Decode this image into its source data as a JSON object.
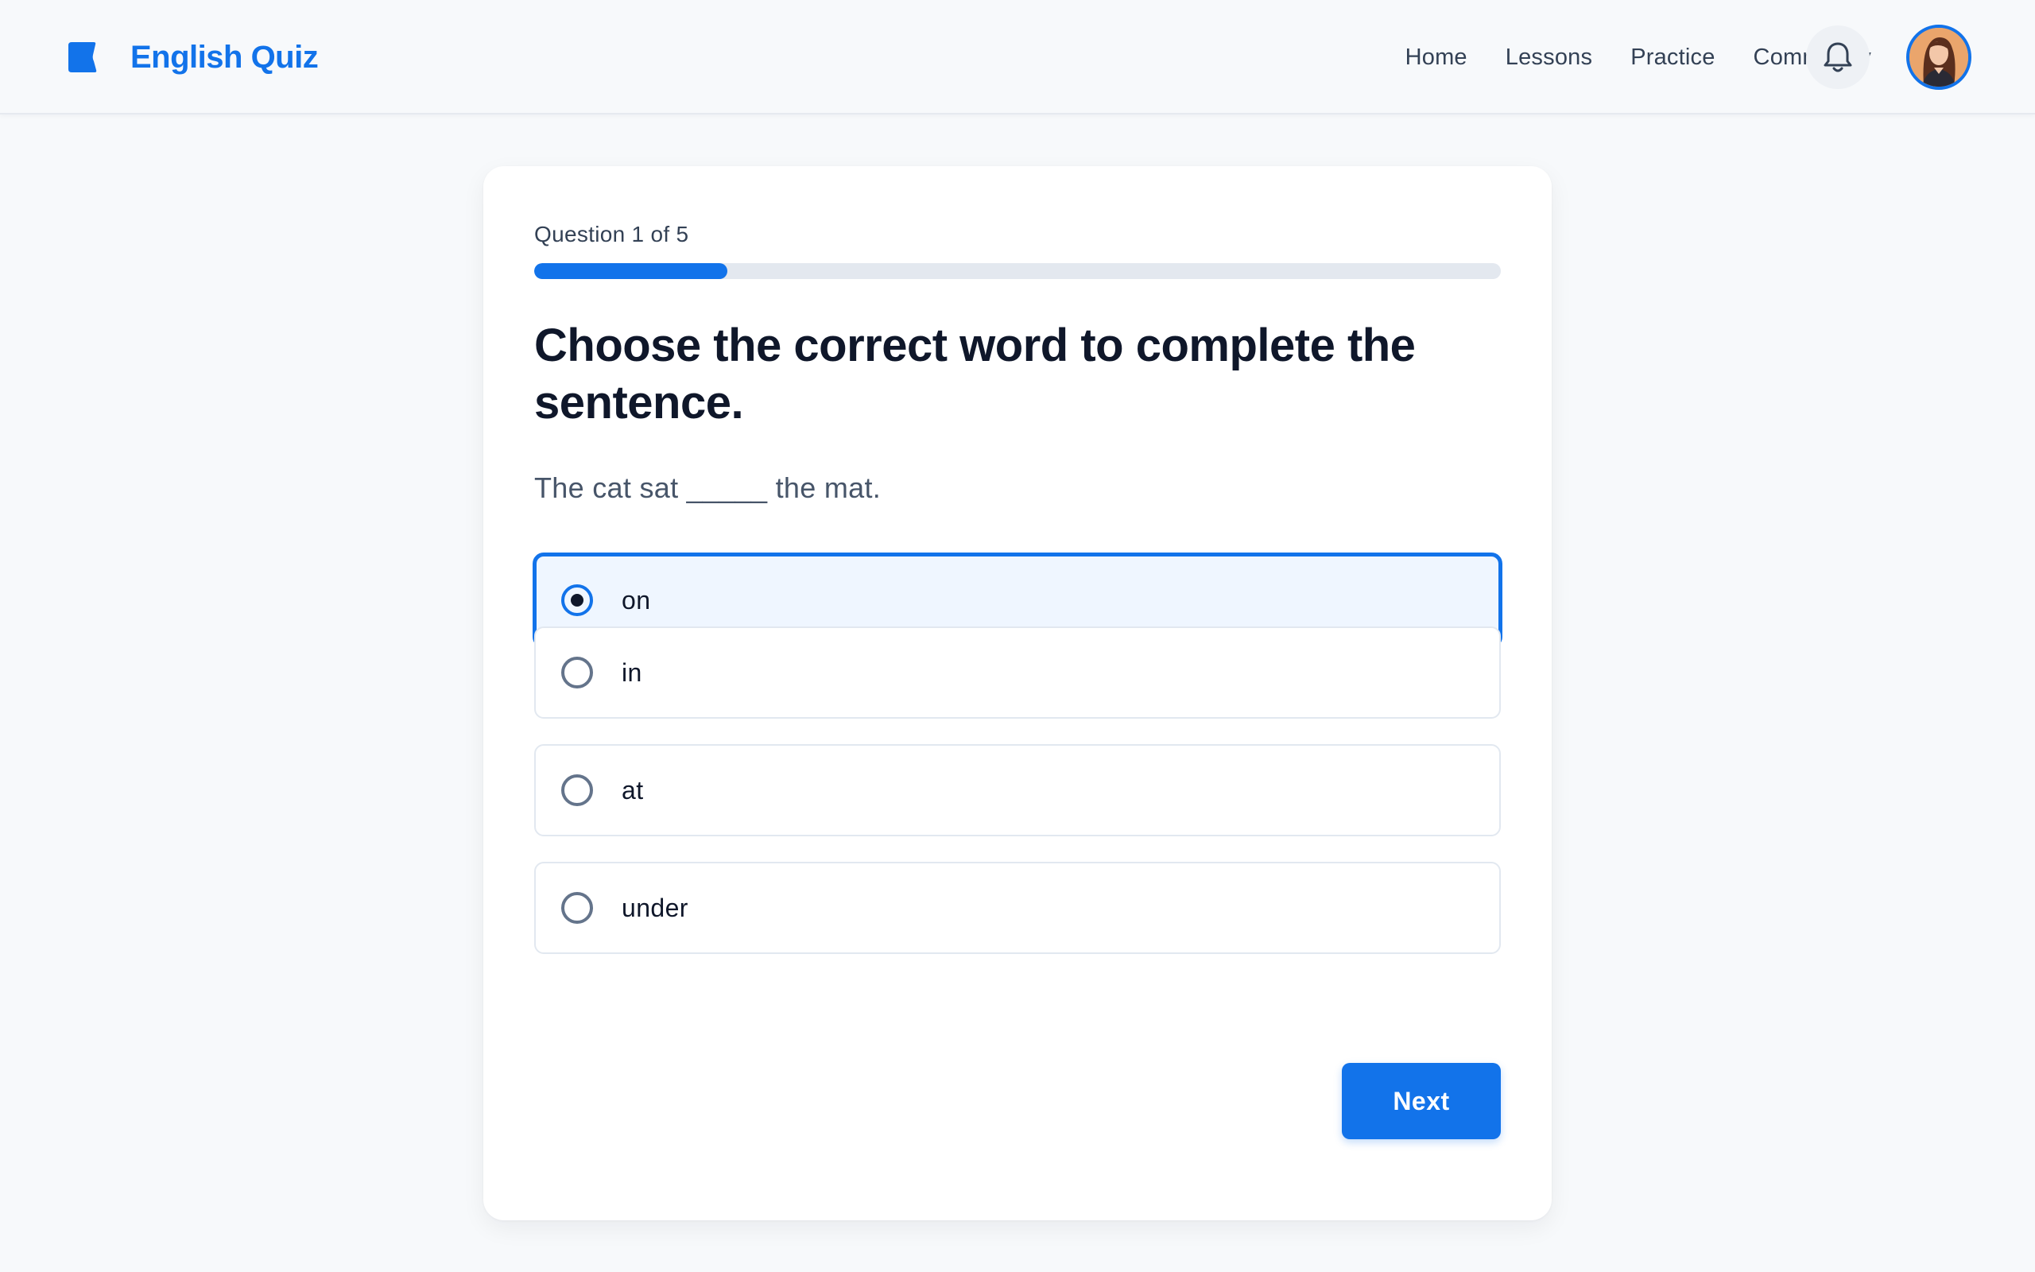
{
  "header": {
    "brand_name": "English Quiz",
    "logo_icon": "book-icon",
    "nav": [
      {
        "label": "Home"
      },
      {
        "label": "Lessons"
      },
      {
        "label": "Practice"
      },
      {
        "label": "Community"
      }
    ],
    "notification_icon": "bell-icon",
    "avatar_icon": "user-avatar"
  },
  "quiz": {
    "counter": "Question 1 of 5",
    "progress_fraction": 0.2,
    "question": "Choose the correct word to complete the sentence.",
    "sentence": "The cat sat _____ the mat.",
    "options": [
      {
        "label": "on",
        "selected": true
      },
      {
        "label": "in",
        "selected": false
      },
      {
        "label": "at",
        "selected": false
      },
      {
        "label": "under",
        "selected": false
      }
    ],
    "next_label": "Next"
  },
  "colors": {
    "accent": "#1273ea",
    "selected_bg": "#eff6ff",
    "border": "#e2e8f0",
    "page_bg": "#f7f9fb"
  }
}
